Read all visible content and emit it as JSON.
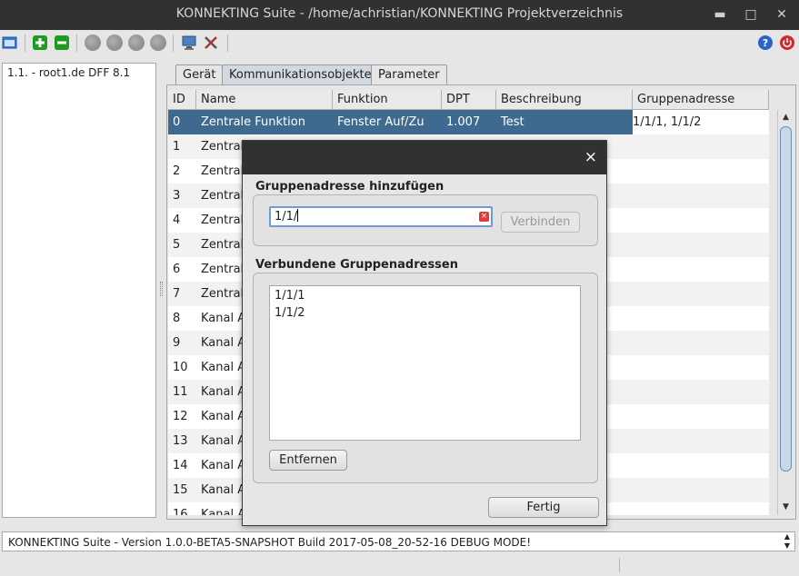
{
  "window": {
    "title": "KONNEKTING Suite - /home/achristian/KONNEKTING Projektverzeichnis",
    "minimize": "▬",
    "maximize": "□",
    "close": "✕"
  },
  "tree": {
    "node": "1.1. - root1.de DFF 8.1"
  },
  "tabs": [
    "Gerät",
    "Kommunikationsobjekte",
    "Parameter"
  ],
  "table": {
    "columns": [
      "ID",
      "Name",
      "Funktion",
      "DPT",
      "Beschreibung",
      "Gruppenadresse"
    ],
    "rows": [
      {
        "id": "0",
        "name": "Zentrale Funktion",
        "funktion": "Fenster Auf/Zu",
        "dpt": "1.007",
        "beschreibung": "Test",
        "ga": "1/1/1, 1/1/2"
      },
      {
        "id": "1",
        "name": "Zentral"
      },
      {
        "id": "2",
        "name": "Zentral"
      },
      {
        "id": "3",
        "name": "Zentral"
      },
      {
        "id": "4",
        "name": "Zentral"
      },
      {
        "id": "5",
        "name": "Zentral"
      },
      {
        "id": "6",
        "name": "Zentral"
      },
      {
        "id": "7",
        "name": "Zentral"
      },
      {
        "id": "8",
        "name": "Kanal A"
      },
      {
        "id": "9",
        "name": "Kanal A"
      },
      {
        "id": "10",
        "name": "Kanal A"
      },
      {
        "id": "11",
        "name": "Kanal A"
      },
      {
        "id": "12",
        "name": "Kanal A"
      },
      {
        "id": "13",
        "name": "Kanal A"
      },
      {
        "id": "14",
        "name": "Kanal A"
      },
      {
        "id": "15",
        "name": "Kanal A"
      },
      {
        "id": "16",
        "name": "Kanal A"
      }
    ]
  },
  "dialog": {
    "close": "×",
    "add_title": "Gruppenadresse hinzufügen",
    "input_value": "1/1/",
    "input_error": "×",
    "connect_label": "Verbinden",
    "connected_title": "Verbundene Gruppenadressen",
    "connected": [
      "1/1/1",
      "1/1/2"
    ],
    "remove_label": "Entfernen",
    "done_label": "Fertig"
  },
  "statusbar": {
    "message": "KONNEKTING Suite - Version 1.0.0-BETA5-SNAPSHOT Build 2017-05-08_20-52-16 DEBUG MODE!"
  },
  "colors": {
    "selection": "#3d6a8e",
    "titlebar": "#2f3133",
    "add_green": "#1e9a1e",
    "help_blue": "#2a64c8",
    "power_red": "#d02a2a"
  }
}
